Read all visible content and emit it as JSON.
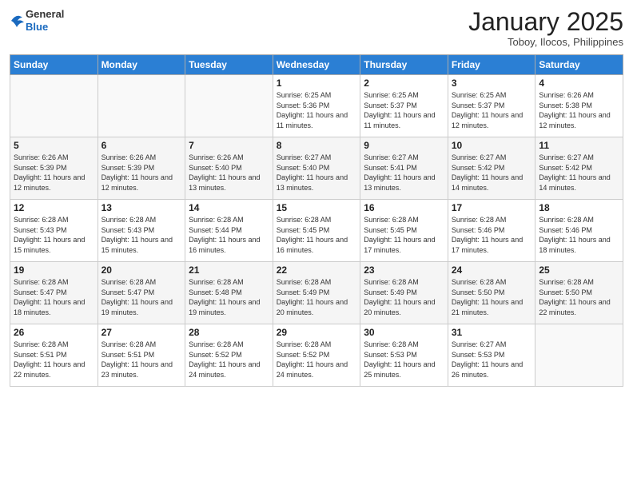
{
  "header": {
    "logo_general": "General",
    "logo_blue": "Blue",
    "month_year": "January 2025",
    "location": "Toboy, Ilocos, Philippines"
  },
  "days_of_week": [
    "Sunday",
    "Monday",
    "Tuesday",
    "Wednesday",
    "Thursday",
    "Friday",
    "Saturday"
  ],
  "weeks": [
    [
      {
        "day": "",
        "sunrise": "",
        "sunset": "",
        "daylight": ""
      },
      {
        "day": "",
        "sunrise": "",
        "sunset": "",
        "daylight": ""
      },
      {
        "day": "",
        "sunrise": "",
        "sunset": "",
        "daylight": ""
      },
      {
        "day": "1",
        "sunrise": "Sunrise: 6:25 AM",
        "sunset": "Sunset: 5:36 PM",
        "daylight": "Daylight: 11 hours and 11 minutes."
      },
      {
        "day": "2",
        "sunrise": "Sunrise: 6:25 AM",
        "sunset": "Sunset: 5:37 PM",
        "daylight": "Daylight: 11 hours and 11 minutes."
      },
      {
        "day": "3",
        "sunrise": "Sunrise: 6:25 AM",
        "sunset": "Sunset: 5:37 PM",
        "daylight": "Daylight: 11 hours and 12 minutes."
      },
      {
        "day": "4",
        "sunrise": "Sunrise: 6:26 AM",
        "sunset": "Sunset: 5:38 PM",
        "daylight": "Daylight: 11 hours and 12 minutes."
      }
    ],
    [
      {
        "day": "5",
        "sunrise": "Sunrise: 6:26 AM",
        "sunset": "Sunset: 5:39 PM",
        "daylight": "Daylight: 11 hours and 12 minutes."
      },
      {
        "day": "6",
        "sunrise": "Sunrise: 6:26 AM",
        "sunset": "Sunset: 5:39 PM",
        "daylight": "Daylight: 11 hours and 12 minutes."
      },
      {
        "day": "7",
        "sunrise": "Sunrise: 6:26 AM",
        "sunset": "Sunset: 5:40 PM",
        "daylight": "Daylight: 11 hours and 13 minutes."
      },
      {
        "day": "8",
        "sunrise": "Sunrise: 6:27 AM",
        "sunset": "Sunset: 5:40 PM",
        "daylight": "Daylight: 11 hours and 13 minutes."
      },
      {
        "day": "9",
        "sunrise": "Sunrise: 6:27 AM",
        "sunset": "Sunset: 5:41 PM",
        "daylight": "Daylight: 11 hours and 13 minutes."
      },
      {
        "day": "10",
        "sunrise": "Sunrise: 6:27 AM",
        "sunset": "Sunset: 5:42 PM",
        "daylight": "Daylight: 11 hours and 14 minutes."
      },
      {
        "day": "11",
        "sunrise": "Sunrise: 6:27 AM",
        "sunset": "Sunset: 5:42 PM",
        "daylight": "Daylight: 11 hours and 14 minutes."
      }
    ],
    [
      {
        "day": "12",
        "sunrise": "Sunrise: 6:28 AM",
        "sunset": "Sunset: 5:43 PM",
        "daylight": "Daylight: 11 hours and 15 minutes."
      },
      {
        "day": "13",
        "sunrise": "Sunrise: 6:28 AM",
        "sunset": "Sunset: 5:43 PM",
        "daylight": "Daylight: 11 hours and 15 minutes."
      },
      {
        "day": "14",
        "sunrise": "Sunrise: 6:28 AM",
        "sunset": "Sunset: 5:44 PM",
        "daylight": "Daylight: 11 hours and 16 minutes."
      },
      {
        "day": "15",
        "sunrise": "Sunrise: 6:28 AM",
        "sunset": "Sunset: 5:45 PM",
        "daylight": "Daylight: 11 hours and 16 minutes."
      },
      {
        "day": "16",
        "sunrise": "Sunrise: 6:28 AM",
        "sunset": "Sunset: 5:45 PM",
        "daylight": "Daylight: 11 hours and 17 minutes."
      },
      {
        "day": "17",
        "sunrise": "Sunrise: 6:28 AM",
        "sunset": "Sunset: 5:46 PM",
        "daylight": "Daylight: 11 hours and 17 minutes."
      },
      {
        "day": "18",
        "sunrise": "Sunrise: 6:28 AM",
        "sunset": "Sunset: 5:46 PM",
        "daylight": "Daylight: 11 hours and 18 minutes."
      }
    ],
    [
      {
        "day": "19",
        "sunrise": "Sunrise: 6:28 AM",
        "sunset": "Sunset: 5:47 PM",
        "daylight": "Daylight: 11 hours and 18 minutes."
      },
      {
        "day": "20",
        "sunrise": "Sunrise: 6:28 AM",
        "sunset": "Sunset: 5:47 PM",
        "daylight": "Daylight: 11 hours and 19 minutes."
      },
      {
        "day": "21",
        "sunrise": "Sunrise: 6:28 AM",
        "sunset": "Sunset: 5:48 PM",
        "daylight": "Daylight: 11 hours and 19 minutes."
      },
      {
        "day": "22",
        "sunrise": "Sunrise: 6:28 AM",
        "sunset": "Sunset: 5:49 PM",
        "daylight": "Daylight: 11 hours and 20 minutes."
      },
      {
        "day": "23",
        "sunrise": "Sunrise: 6:28 AM",
        "sunset": "Sunset: 5:49 PM",
        "daylight": "Daylight: 11 hours and 20 minutes."
      },
      {
        "day": "24",
        "sunrise": "Sunrise: 6:28 AM",
        "sunset": "Sunset: 5:50 PM",
        "daylight": "Daylight: 11 hours and 21 minutes."
      },
      {
        "day": "25",
        "sunrise": "Sunrise: 6:28 AM",
        "sunset": "Sunset: 5:50 PM",
        "daylight": "Daylight: 11 hours and 22 minutes."
      }
    ],
    [
      {
        "day": "26",
        "sunrise": "Sunrise: 6:28 AM",
        "sunset": "Sunset: 5:51 PM",
        "daylight": "Daylight: 11 hours and 22 minutes."
      },
      {
        "day": "27",
        "sunrise": "Sunrise: 6:28 AM",
        "sunset": "Sunset: 5:51 PM",
        "daylight": "Daylight: 11 hours and 23 minutes."
      },
      {
        "day": "28",
        "sunrise": "Sunrise: 6:28 AM",
        "sunset": "Sunset: 5:52 PM",
        "daylight": "Daylight: 11 hours and 24 minutes."
      },
      {
        "day": "29",
        "sunrise": "Sunrise: 6:28 AM",
        "sunset": "Sunset: 5:52 PM",
        "daylight": "Daylight: 11 hours and 24 minutes."
      },
      {
        "day": "30",
        "sunrise": "Sunrise: 6:28 AM",
        "sunset": "Sunset: 5:53 PM",
        "daylight": "Daylight: 11 hours and 25 minutes."
      },
      {
        "day": "31",
        "sunrise": "Sunrise: 6:27 AM",
        "sunset": "Sunset: 5:53 PM",
        "daylight": "Daylight: 11 hours and 26 minutes."
      },
      {
        "day": "",
        "sunrise": "",
        "sunset": "",
        "daylight": ""
      }
    ]
  ]
}
